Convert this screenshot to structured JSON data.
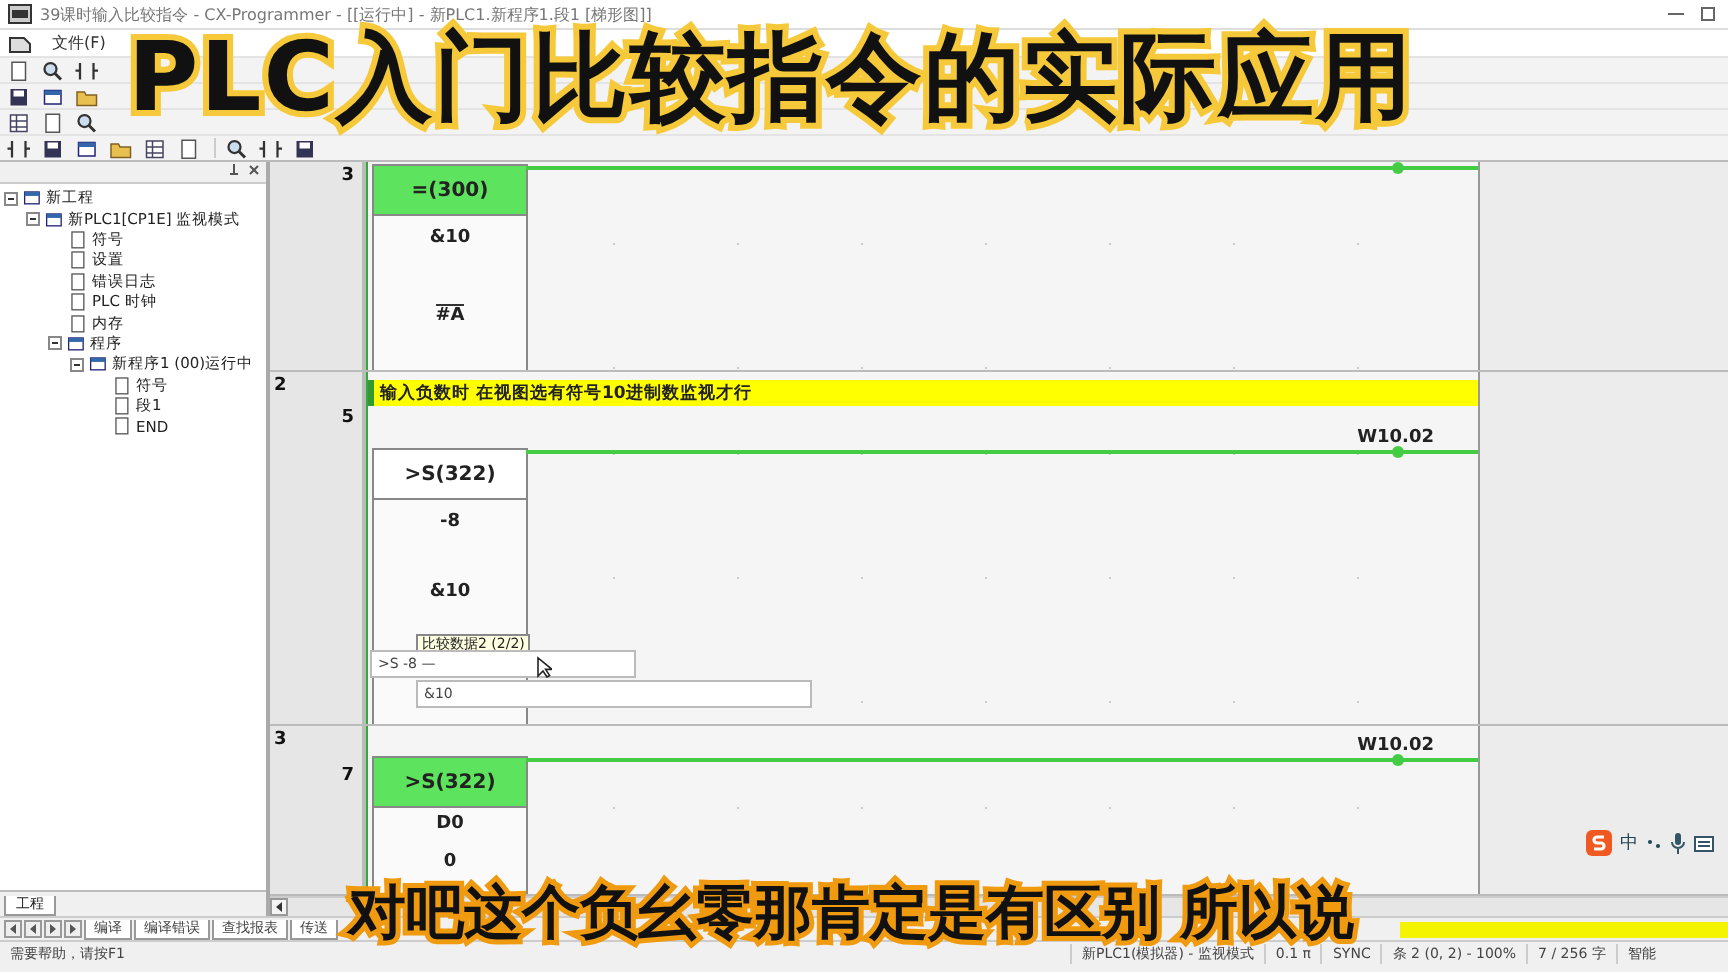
{
  "window": {
    "title": "39课时输入比较指令 - CX-Programmer - [[运行中] - 新PLC1.新程序1.段1 [梯形图]]"
  },
  "menu": [
    "文件(F)"
  ],
  "overlay_title": "PLC入门比较指令的实际应用",
  "project_tree": {
    "items": [
      {
        "label": "新工程",
        "expanded": true,
        "children": [
          {
            "label": "新PLC1[CP1E] 监视模式",
            "expanded": true,
            "children": [
              {
                "label": "符号"
              },
              {
                "label": "设置"
              },
              {
                "label": "错误日志"
              },
              {
                "label": "PLC 时钟"
              },
              {
                "label": "内存"
              },
              {
                "label": "程序",
                "expanded": true,
                "children": [
                  {
                    "label": "新程序1 (00)运行中",
                    "expanded": true,
                    "children": [
                      {
                        "label": "符号"
                      },
                      {
                        "label": "段1"
                      },
                      {
                        "label": "END"
                      }
                    ]
                  }
                ]
              }
            ]
          }
        ]
      }
    ]
  },
  "left_tab": "工程",
  "ladder": {
    "rungs": [
      {
        "step": "3",
        "instruction": {
          "mnemonic": "=(300)",
          "active": true,
          "operands": [
            "&10",
            "#A"
          ]
        }
      },
      {
        "rung": "2",
        "step": "5",
        "comment": "输入负数时 在视图选有符号10进制数监视才行",
        "output": "W10.02",
        "instruction": {
          "mnemonic": ">S(322)",
          "active": false,
          "operands": [
            "-8",
            "&10"
          ]
        },
        "tooltip": "比较数据2 (2/2)",
        "editor": {
          "value": ">S -8 —",
          "next_line": "&10"
        }
      },
      {
        "rung": "3",
        "step": "7",
        "output": "W10.02",
        "instruction": {
          "mnemonic": ">S(322)",
          "active": true,
          "operands": [
            "D0",
            "0"
          ]
        }
      }
    ]
  },
  "ime_toolbar": {
    "language": "中"
  },
  "bottom_tabs": [
    "编译",
    "编译错误",
    "查找报表",
    "传送"
  ],
  "caption": "对吧这个负幺零那肯定是有区别 所以说",
  "status_bar": {
    "help": "需要帮助，请按F1",
    "segments": [
      "新PLC1(模拟器) - 监视模式",
      "0.1 π",
      "SYNC",
      "条 2 (0, 2) - 100%",
      "7 / 256 字",
      "智能"
    ]
  }
}
